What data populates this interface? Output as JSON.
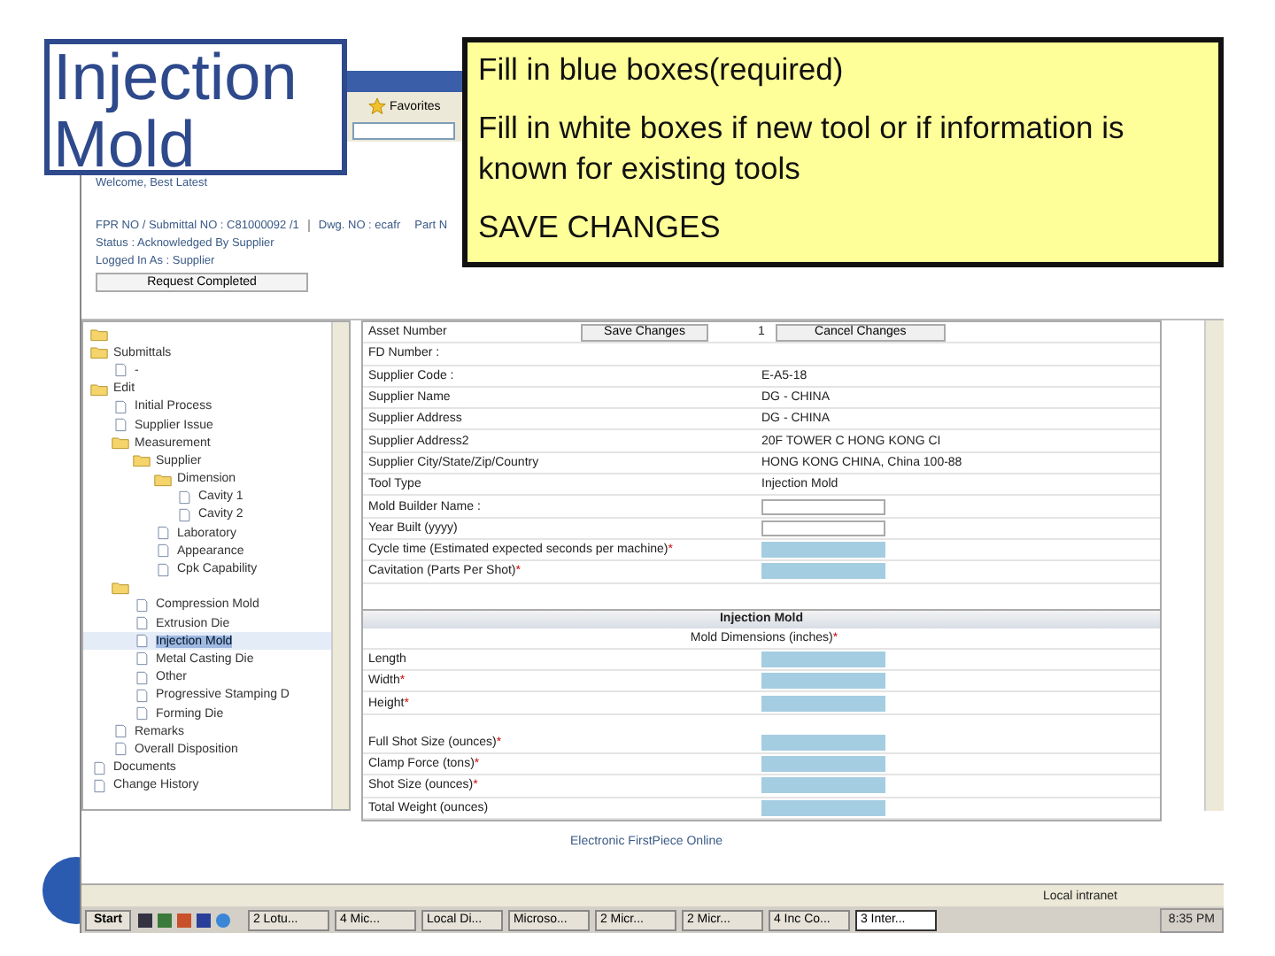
{
  "slide": {
    "title": "Injection Mold",
    "notes": [
      {
        "text": "Fill in blue boxes(required)"
      },
      {
        "text": "Fill in white boxes if new tool or if information is known for existing tools"
      },
      {
        "text": "SAVE CHANGES"
      }
    ]
  },
  "browser": {
    "toolbar": {
      "favorites": "Favorites"
    },
    "header": {
      "welcome": "Welcome, Best Latest",
      "fpr": "FPR NO / Submittal NO : C81000092 /1",
      "dwg": "Dwg. NO : ecafr",
      "part": "Part N",
      "status": "Status : Acknowledged By Supplier",
      "logged_in": "Logged In As : Supplier",
      "request_button": "Request Completed"
    },
    "tree": [
      {
        "kind": "folder"
      },
      {
        "kind": "folder",
        "label": "Submittals",
        "selected": false,
        "children": [
          {
            "kind": "doc",
            "label": "-",
            "selected": false
          }
        ]
      },
      {
        "kind": "folder",
        "label": "Edit",
        "selected": false,
        "children": [
          {
            "kind": "doc",
            "label": "Initial Process",
            "selected": false
          },
          {
            "kind": "doc",
            "label": "Supplier Issue",
            "selected": false
          },
          {
            "kind": "folder",
            "label": "Measurement",
            "selected": false,
            "children": [
              {
                "kind": "folder",
                "label": "Supplier",
                "selected": false,
                "children": [
                  {
                    "kind": "folder",
                    "label": "Dimension",
                    "selected": false,
                    "children": [
                      {
                        "kind": "doc",
                        "label": "Cavity 1",
                        "selected": false
                      },
                      {
                        "kind": "doc",
                        "label": "Cavity 2",
                        "selected": false
                      }
                    ]
                  },
                  {
                    "kind": "doc",
                    "label": "Laboratory",
                    "selected": false
                  },
                  {
                    "kind": "doc",
                    "label": "Appearance",
                    "selected": false
                  },
                  {
                    "kind": "doc",
                    "label": "Cpk Capability",
                    "selected": false
                  }
                ]
              }
            ]
          },
          {
            "kind": "folder",
            "children": [
              {
                "kind": "doc",
                "label": "Compression Mold",
                "selected": false
              },
              {
                "kind": "doc",
                "label": "Extrusion Die",
                "selected": false
              },
              {
                "kind": "doc",
                "label": "Injection Mold",
                "selected": true
              },
              {
                "kind": "doc",
                "label": "Metal Casting Die",
                "selected": false
              },
              {
                "kind": "doc",
                "label": "Other",
                "selected": false
              },
              {
                "kind": "doc",
                "label": "Progressive Stamping D",
                "selected": false
              },
              {
                "kind": "doc",
                "label": "Forming Die",
                "selected": false
              }
            ]
          },
          {
            "kind": "doc",
            "label": "Remarks",
            "selected": false
          },
          {
            "kind": "doc",
            "label": "Overall Disposition",
            "selected": false
          }
        ]
      },
      {
        "kind": "doc",
        "label": "Documents",
        "selected": false
      },
      {
        "kind": "doc",
        "label": "Change History",
        "selected": false
      }
    ],
    "form": {
      "top_row": {
        "label": "Asset Number",
        "save_button": "Save Changes",
        "value": "1",
        "cancel_button": "Cancel Changes"
      },
      "rows": [
        {
          "kind": "text",
          "label": "FD Number :"
        },
        {
          "kind": "text",
          "label": "Supplier Code :",
          "value": "E-A5-18"
        },
        {
          "kind": "text",
          "label": "Supplier Name",
          "value": "DG - CHINA"
        },
        {
          "kind": "text",
          "label": "Supplier Address",
          "value": "DG - CHINA"
        },
        {
          "kind": "text",
          "label": "Supplier Address2",
          "value": "20F TOWER C HONG KONG CI"
        },
        {
          "kind": "text",
          "label": "Supplier City/State/Zip/Country",
          "value": "HONG KONG CHINA, China 100-88"
        },
        {
          "kind": "text",
          "label": "Tool Type",
          "value": "Injection Mold"
        },
        {
          "kind": "field",
          "label": "Mold Builder Name :",
          "required": false
        },
        {
          "kind": "field",
          "label": "Year Built (yyyy)",
          "required": false
        },
        {
          "kind": "field",
          "label": "Cycle time (Estimated expected seconds per machine)",
          "marker": "*",
          "required": true
        },
        {
          "kind": "field",
          "label": "Cavitation (Parts Per Shot)",
          "marker": "*",
          "required": true
        }
      ],
      "section": {
        "title": "Injection Mold",
        "subtitle": "Mold Dimensions (inches)",
        "subtitle_marker": "*",
        "rows": [
          {
            "kind": "field",
            "label": "Length",
            "required": true
          },
          {
            "kind": "field",
            "label": "Width",
            "marker": "*",
            "required": true
          },
          {
            "kind": "field",
            "label": "Height",
            "marker": "*",
            "required": true
          },
          {
            "kind": "gap"
          },
          {
            "kind": "field",
            "label": "Full Shot Size (ounces)",
            "marker": "*",
            "required": true
          },
          {
            "kind": "field",
            "label": "Clamp Force (tons)",
            "marker": "*",
            "required": true
          },
          {
            "kind": "field",
            "label": "Shot Size (ounces)",
            "marker": "*",
            "required": true
          },
          {
            "kind": "field",
            "label": "Total Weight (ounces)",
            "required": true
          }
        ]
      }
    },
    "footer": "Electronic FirstPiece Online",
    "status_bar": {
      "zone": "Local intranet"
    }
  },
  "taskbar": {
    "start": "Start",
    "tasks": [
      {
        "label": "2 Lotu...",
        "selected": false
      },
      {
        "label": "4 Mic...",
        "selected": false
      },
      {
        "label": "Local Di...",
        "selected": false
      },
      {
        "label": "Microso...",
        "selected": false
      },
      {
        "label": "2 Micr...",
        "selected": false
      },
      {
        "label": "2 Micr...",
        "selected": false
      },
      {
        "label": "4 Inc Co...",
        "selected": false
      },
      {
        "label": "3 Inter...",
        "selected": true
      }
    ],
    "clock": "8:35 PM"
  }
}
